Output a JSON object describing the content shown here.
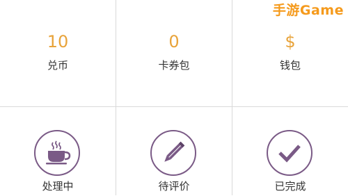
{
  "stats": [
    {
      "value": "10",
      "label": "兑币"
    },
    {
      "value": "0",
      "label": "卡券包"
    },
    {
      "value": "$",
      "label": "钱包"
    }
  ],
  "orders": [
    {
      "label": "处理中",
      "icon": "coffee-cup-icon"
    },
    {
      "label": "待评价",
      "icon": "pencil-icon"
    },
    {
      "label": "已完成",
      "icon": "checkmark-icon"
    }
  ],
  "watermark": "手游Game",
  "colors": {
    "value": "#e8a33a",
    "icon": "#7a5a86",
    "divider": "#d9d9d9",
    "watermark": "#f59a1c"
  }
}
